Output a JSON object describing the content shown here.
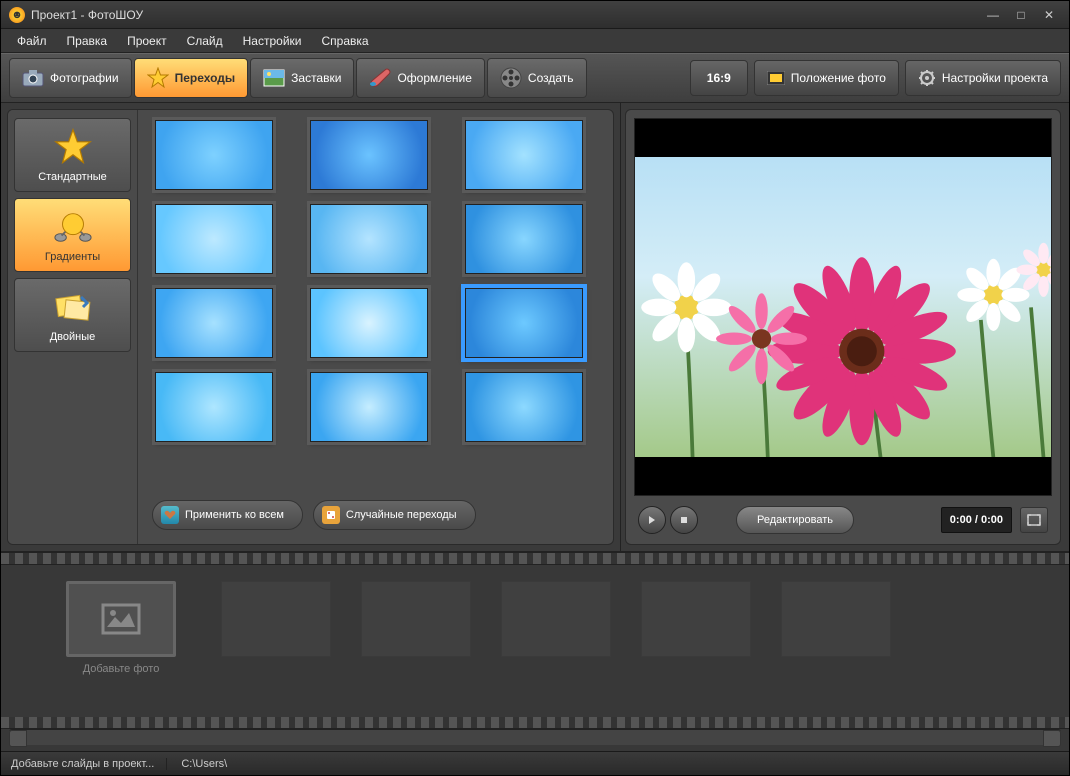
{
  "window": {
    "title": "Проект1 - ФотоШОУ"
  },
  "menu": {
    "items": [
      "Файл",
      "Правка",
      "Проект",
      "Слайд",
      "Настройки",
      "Справка"
    ]
  },
  "tabs": {
    "items": [
      {
        "id": "photos",
        "label": "Фотографии",
        "icon": "camera-icon"
      },
      {
        "id": "transitions",
        "label": "Переходы",
        "icon": "star-icon"
      },
      {
        "id": "splash",
        "label": "Заставки",
        "icon": "image-icon"
      },
      {
        "id": "design",
        "label": "Оформление",
        "icon": "brush-icon"
      },
      {
        "id": "create",
        "label": "Создать",
        "icon": "reel-icon"
      }
    ],
    "active": "transitions"
  },
  "toolbar": {
    "aspect_label": "16:9",
    "position_label": "Положение фото",
    "settings_label": "Настройки проекта"
  },
  "categories": {
    "items": [
      {
        "id": "standard",
        "label": "Стандартные",
        "icon": "star-icon"
      },
      {
        "id": "gradients",
        "label": "Градиенты",
        "icon": "gradient-icon"
      },
      {
        "id": "double",
        "label": "Двойные",
        "icon": "double-icon"
      }
    ],
    "active": "gradients"
  },
  "grid": {
    "thumbs": [
      {
        "id": "grad-01",
        "color1": "#3fa4f0",
        "color2": "#7ed1ff"
      },
      {
        "id": "grad-02",
        "color1": "#2d7ad6",
        "color2": "#6bc3ff"
      },
      {
        "id": "grad-03",
        "color1": "#4aa9f3",
        "color2": "#a3e2ff"
      },
      {
        "id": "grad-04",
        "color1": "#66c8ff",
        "color2": "#bde9ff"
      },
      {
        "id": "grad-05",
        "color1": "#58b6f2",
        "color2": "#b4e4ff"
      },
      {
        "id": "grad-06",
        "color1": "#2f91e0",
        "color2": "#88d6ff"
      },
      {
        "id": "grad-07",
        "color1": "#3ea6f2",
        "color2": "#a6e1ff"
      },
      {
        "id": "grad-08",
        "color1": "#5cc4ff",
        "color2": "#d9f3ff"
      },
      {
        "id": "grad-09",
        "color1": "#2c87db",
        "color2": "#6dc9ff"
      },
      {
        "id": "grad-10",
        "color1": "#48b9f6",
        "color2": "#aee6ff"
      },
      {
        "id": "grad-11",
        "color1": "#3ba6f1",
        "color2": "#c5edff"
      },
      {
        "id": "grad-12",
        "color1": "#2f95e3",
        "color2": "#8dd9ff"
      }
    ],
    "selected": "grad-09",
    "apply_all_label": "Применить ко всем",
    "random_label": "Случайные переходы"
  },
  "preview": {
    "edit_label": "Редактировать",
    "time_display": "0:00 / 0:00"
  },
  "timeline": {
    "add_photo_label": "Добавьте фото",
    "placeholder_count": 5
  },
  "statusbar": {
    "hint": "Добавьте слайды в проект...",
    "path": "C:\\Users\\"
  }
}
